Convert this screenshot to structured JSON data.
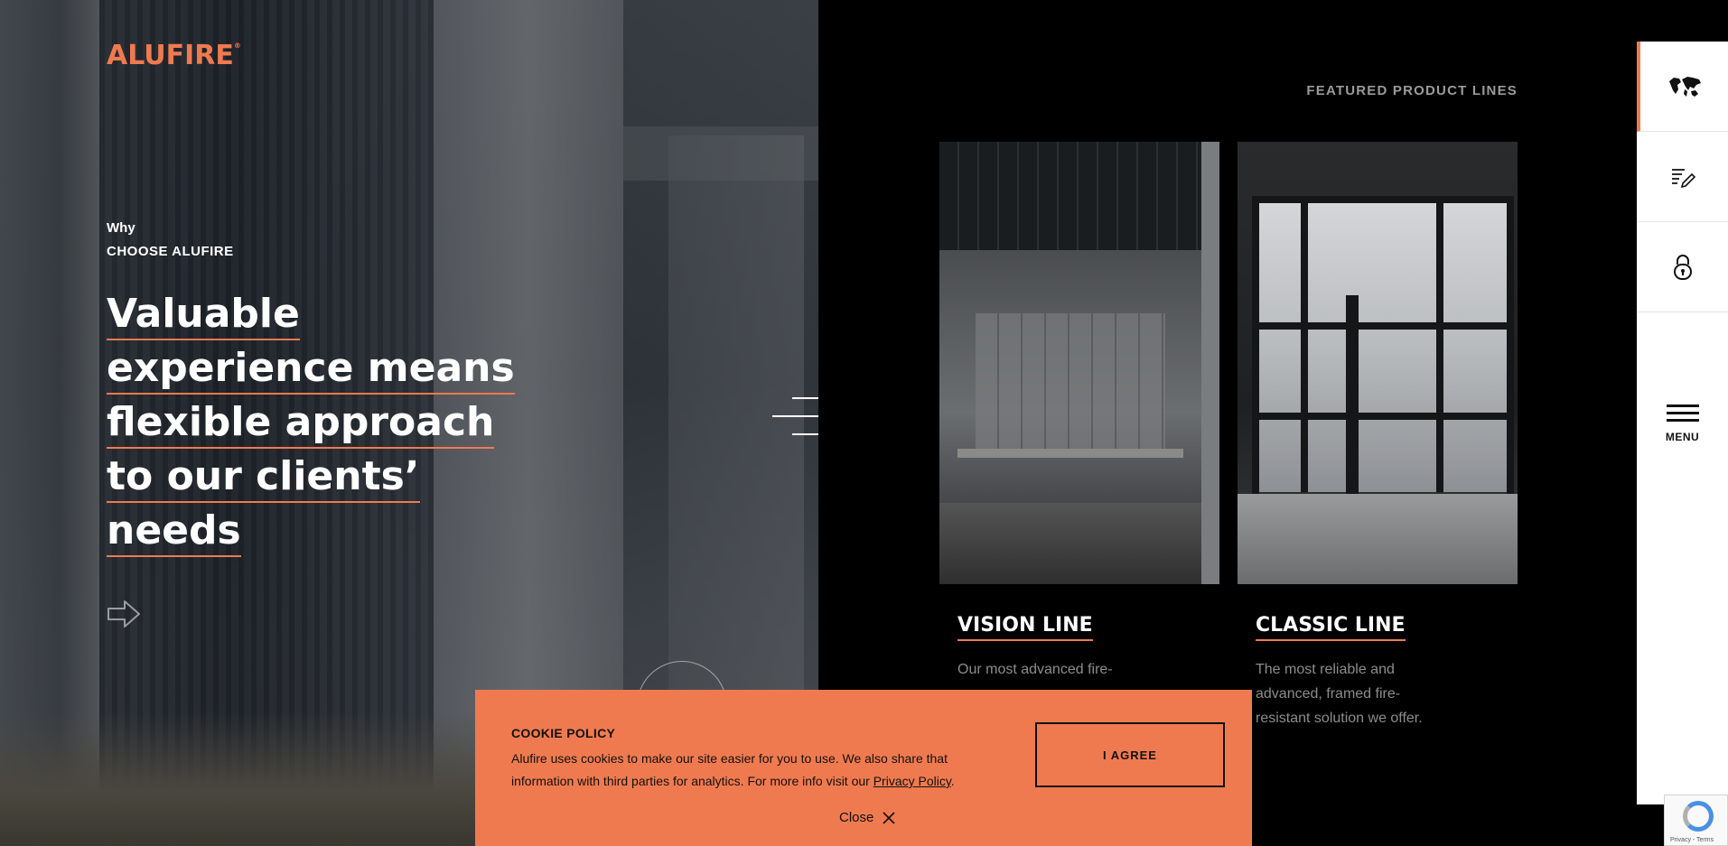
{
  "brand": {
    "logo": "ALUFIRE",
    "registered": "®",
    "accent": "#f07a4f"
  },
  "hero": {
    "eyebrow_small": "Why",
    "eyebrow": "CHOOSE ALUFIRE",
    "headline_lines": [
      "Valuable",
      "experience means",
      "flexible approach",
      "to our clients’",
      "needs"
    ],
    "next_icon": "arrow-right-outline-icon"
  },
  "featured": {
    "heading": "FEATURED PRODUCT LINES",
    "cards": [
      {
        "title": "VISION LINE",
        "description": "Our most advanced fire-"
      },
      {
        "title": "CLASSIC LINE",
        "description": "The most reliable and advanced, framed fire-resistant solution we offer."
      }
    ]
  },
  "sidebar": {
    "items": [
      {
        "icon": "world-map-icon"
      },
      {
        "icon": "edit-list-icon"
      },
      {
        "icon": "lock-icon"
      }
    ],
    "menu_label": "MENU"
  },
  "cookie": {
    "title": "COOKIE POLICY",
    "text": "Alufire uses cookies to make our site easier for you to use. We also share that information with third parties for analytics. For more info visit our ",
    "link": "Privacy Policy",
    "after_link": ".",
    "agree": "I AGREE",
    "close": "Close"
  },
  "recaptcha": {
    "label": "Privacy - Terms"
  }
}
